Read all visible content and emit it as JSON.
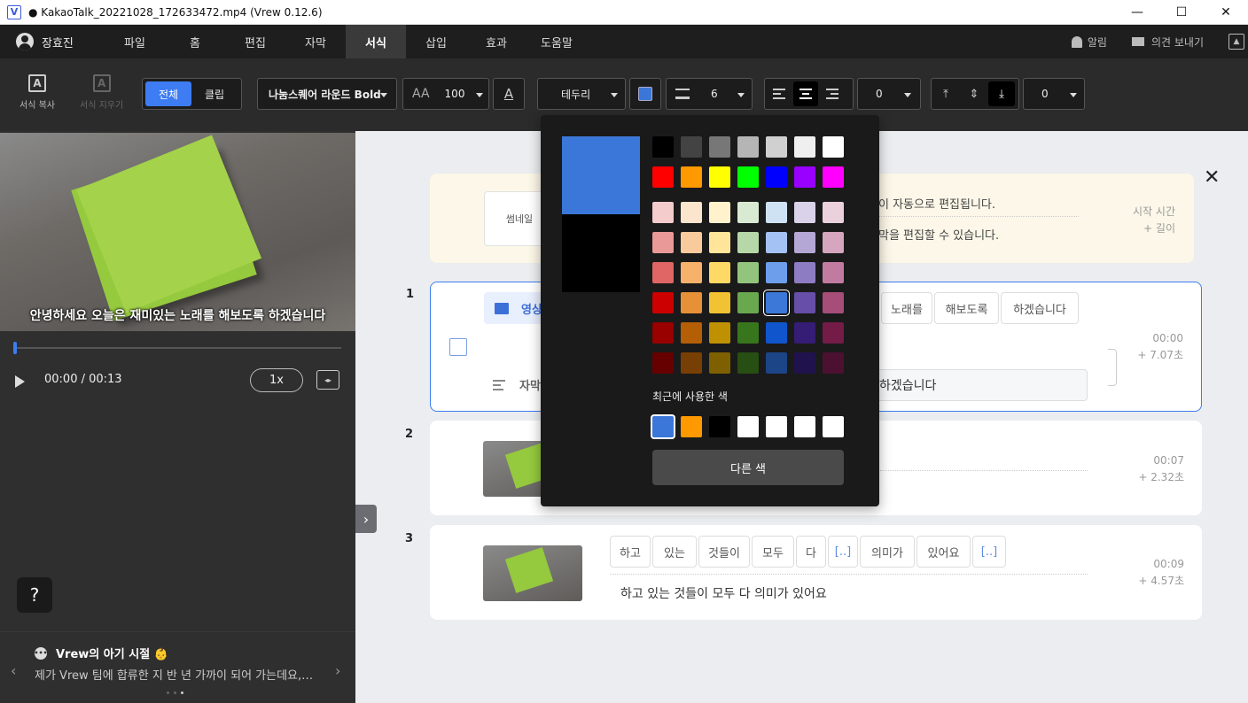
{
  "window": {
    "title": "● KakaoTalk_20221028_172633472.mp4 (Vrew 0.12.6)",
    "logo": "V"
  },
  "menubar": {
    "user_name": "장효진",
    "items": [
      "파일",
      "홈",
      "편집",
      "자막",
      "서식",
      "삽입",
      "효과",
      "도움말"
    ],
    "active": "서식",
    "notifications": "알림",
    "feedback": "의견 보내기"
  },
  "toolbar": {
    "copy_format": "서식 복사",
    "clear_format": "서식 지우기",
    "scope_all": "전체",
    "scope_clip": "클립",
    "font": "나눔스퀘어 라운드 Bold",
    "font_size": "100",
    "outline": "테두리",
    "outline_color": "#3b77d8",
    "outline_width": "6",
    "letter_spacing": "0",
    "vertical_offset": "0"
  },
  "player": {
    "caption": "안녕하세요 오늘은 재미있는 노래를 해보도록 하겠습니다",
    "time": "00:00 / 00:13",
    "speed": "1x",
    "progress": 0.0
  },
  "news": {
    "title": "Vrew의 아기 시절 👶",
    "body": "제가 Vrew 팀에 합류한 지 반 년 가까이 되어 가는데요,왠...",
    "page": 3,
    "pages": 3
  },
  "notice": {
    "thumb_hint": "썸네일",
    "line1": "이 자동으로 편집됩니다.",
    "line2": "막을 편집할 수 있습니다.",
    "start_time": "시작 시간",
    "plus_length": "+ 길이"
  },
  "clips": [
    {
      "num": "1",
      "scene_label": "영상",
      "words": [
        "노래를",
        "해보도록",
        "하겠습니다"
      ],
      "sub_label": "자막",
      "subtitle": "하겠습니다",
      "start": "00:00",
      "length": "+  7.07초"
    },
    {
      "num": "2",
      "start": "00:07",
      "length": "+  2.32초"
    },
    {
      "num": "3",
      "words": [
        "하고",
        "있는",
        "것들이",
        "모두",
        "다",
        "[..]",
        "의미가",
        "있어요",
        "[..]"
      ],
      "subtitle": "하고 있는 것들이 모두 다 의미가 있어요",
      "start": "00:09",
      "length": "+  4.57초"
    }
  ],
  "color_picker": {
    "current": "#3b77d8",
    "previous": "#000000",
    "palette": [
      [
        "#000000",
        "#434343",
        "#777777",
        "#b5b5b5",
        "#d0d0d0",
        "#efefef",
        "#ffffff"
      ],
      [
        "#ff0000",
        "#ff9900",
        "#ffff00",
        "#00ff00",
        "#0000ff",
        "#9900ff",
        "#ff00ff"
      ],
      [
        "#f4cccc",
        "#fce5cd",
        "#fff2cc",
        "#d9ead3",
        "#cfe2f3",
        "#d9d2e9",
        "#ead1dc"
      ],
      [
        "#ea9999",
        "#f9cb9c",
        "#ffe599",
        "#b6d7a8",
        "#a4c2f4",
        "#b4a7d6",
        "#d5a6bd"
      ],
      [
        "#e06666",
        "#f6b26b",
        "#ffd966",
        "#93c47d",
        "#6d9eeb",
        "#8e7cc3",
        "#c27ba0"
      ],
      [
        "#cc0000",
        "#e69138",
        "#f1c232",
        "#6aa84f",
        "#3c78d8",
        "#674ea7",
        "#a64d79"
      ],
      [
        "#990000",
        "#b45f06",
        "#bf9000",
        "#38761d",
        "#1155cc",
        "#351c75",
        "#741b47"
      ],
      [
        "#660000",
        "#783f04",
        "#7f6000",
        "#274e13",
        "#1c4587",
        "#20124d",
        "#4c1130"
      ]
    ],
    "selected_row": 5,
    "selected_col": 4,
    "recent_label": "최근에 사용한 색",
    "recent": [
      "#3b77d8",
      "#ff9900",
      "#000000",
      "#ffffff",
      "#ffffff",
      "#ffffff",
      "#ffffff"
    ],
    "more_button": "다른 색"
  }
}
